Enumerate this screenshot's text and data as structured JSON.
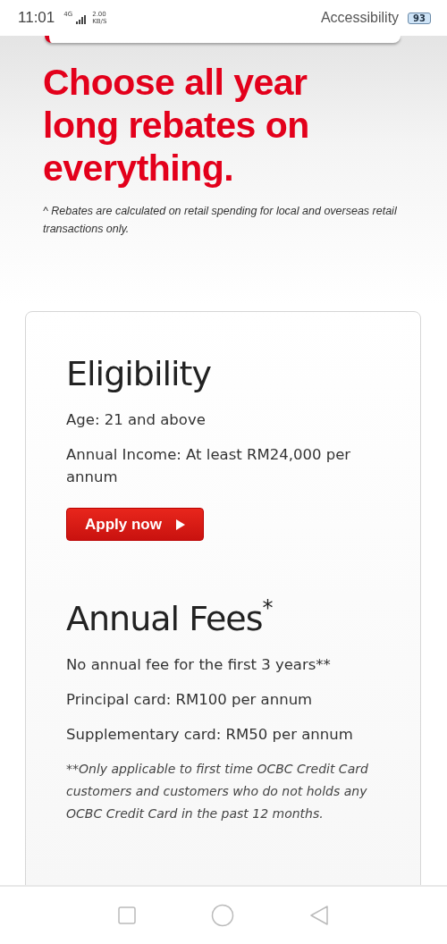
{
  "status_bar": {
    "time": "11:01",
    "network": "4G",
    "speed": "2.00",
    "speed_unit": "KB/S",
    "accessibility": "Accessibility",
    "battery": "93"
  },
  "hero": {
    "headline": "Choose all year long rebates on everything.",
    "footnote": "^ Rebates are calculated on retail spending for local and overseas retail transactions only."
  },
  "sections": [
    {
      "title": "Eligibility",
      "lines": [
        "Age: 21 and above",
        "Annual Income: At least RM24,000 per annum"
      ],
      "button": "Apply now"
    },
    {
      "title": "Annual Fees$^{*}$",
      "lines": [
        "No annual fee for the first 3 years**",
        "Principal card: RM100 per annum",
        "Supplementary card: RM50 per annum"
      ],
      "note": "**Only applicable to first time OCBC Credit Card customers and customers who do not holds any OCBC Credit Card in the past 12 months."
    }
  ]
}
